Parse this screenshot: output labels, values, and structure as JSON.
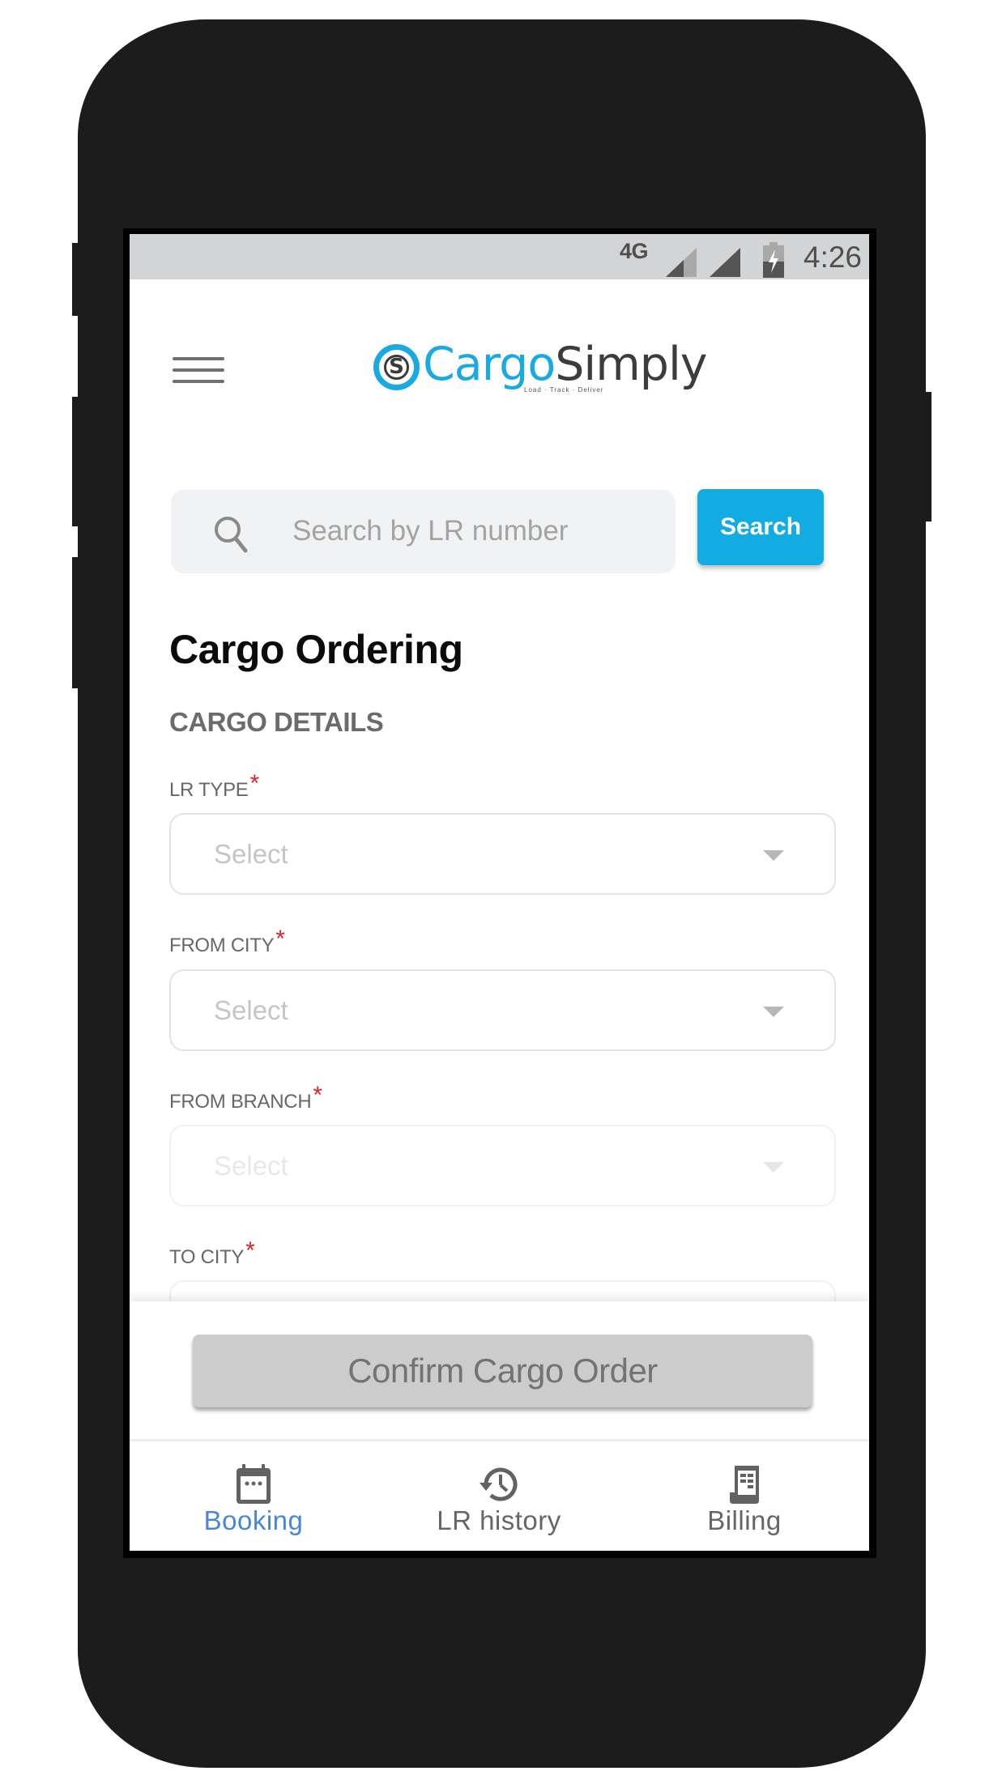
{
  "status_bar": {
    "network": "4G",
    "time": "4:26",
    "icons": [
      "signal-icon",
      "signal-icon",
      "battery-charging-icon"
    ]
  },
  "header": {
    "menu_icon": "hamburger-menu-icon",
    "logo": {
      "mark": "S",
      "brand_part1": "Cargo",
      "brand_part2": "Simply",
      "tagline": "Load · Track · Deliver",
      "colors": {
        "primary": "#1ba9e1",
        "secondary": "#3c3c3c"
      }
    }
  },
  "search": {
    "icon": "search-icon",
    "placeholder": "Search by LR number",
    "value": "",
    "button_label": "Search",
    "button_color": "#12ace3"
  },
  "page": {
    "title": "Cargo Ordering",
    "section_title": "CARGO DETAILS",
    "required_marker": "*",
    "required_color": "#e0222a",
    "fields": [
      {
        "label": "LR TYPE",
        "required": true,
        "placeholder": "Select",
        "disabled": false
      },
      {
        "label": "FROM CITY",
        "required": true,
        "placeholder": "Select",
        "disabled": false
      },
      {
        "label": "FROM BRANCH",
        "required": true,
        "placeholder": "Select",
        "disabled": true
      },
      {
        "label": "TO CITY",
        "required": true,
        "placeholder": "",
        "disabled": true
      }
    ]
  },
  "footer": {
    "confirm_label": "Confirm Cargo Order",
    "confirm_enabled": false
  },
  "bottom_nav": {
    "active_color": "#4a86d8",
    "items": [
      {
        "label": "Booking",
        "icon": "calendar-icon",
        "active": true
      },
      {
        "label": "LR history",
        "icon": "history-icon",
        "active": false
      },
      {
        "label": "Billing",
        "icon": "receipt-icon",
        "active": false
      }
    ]
  }
}
